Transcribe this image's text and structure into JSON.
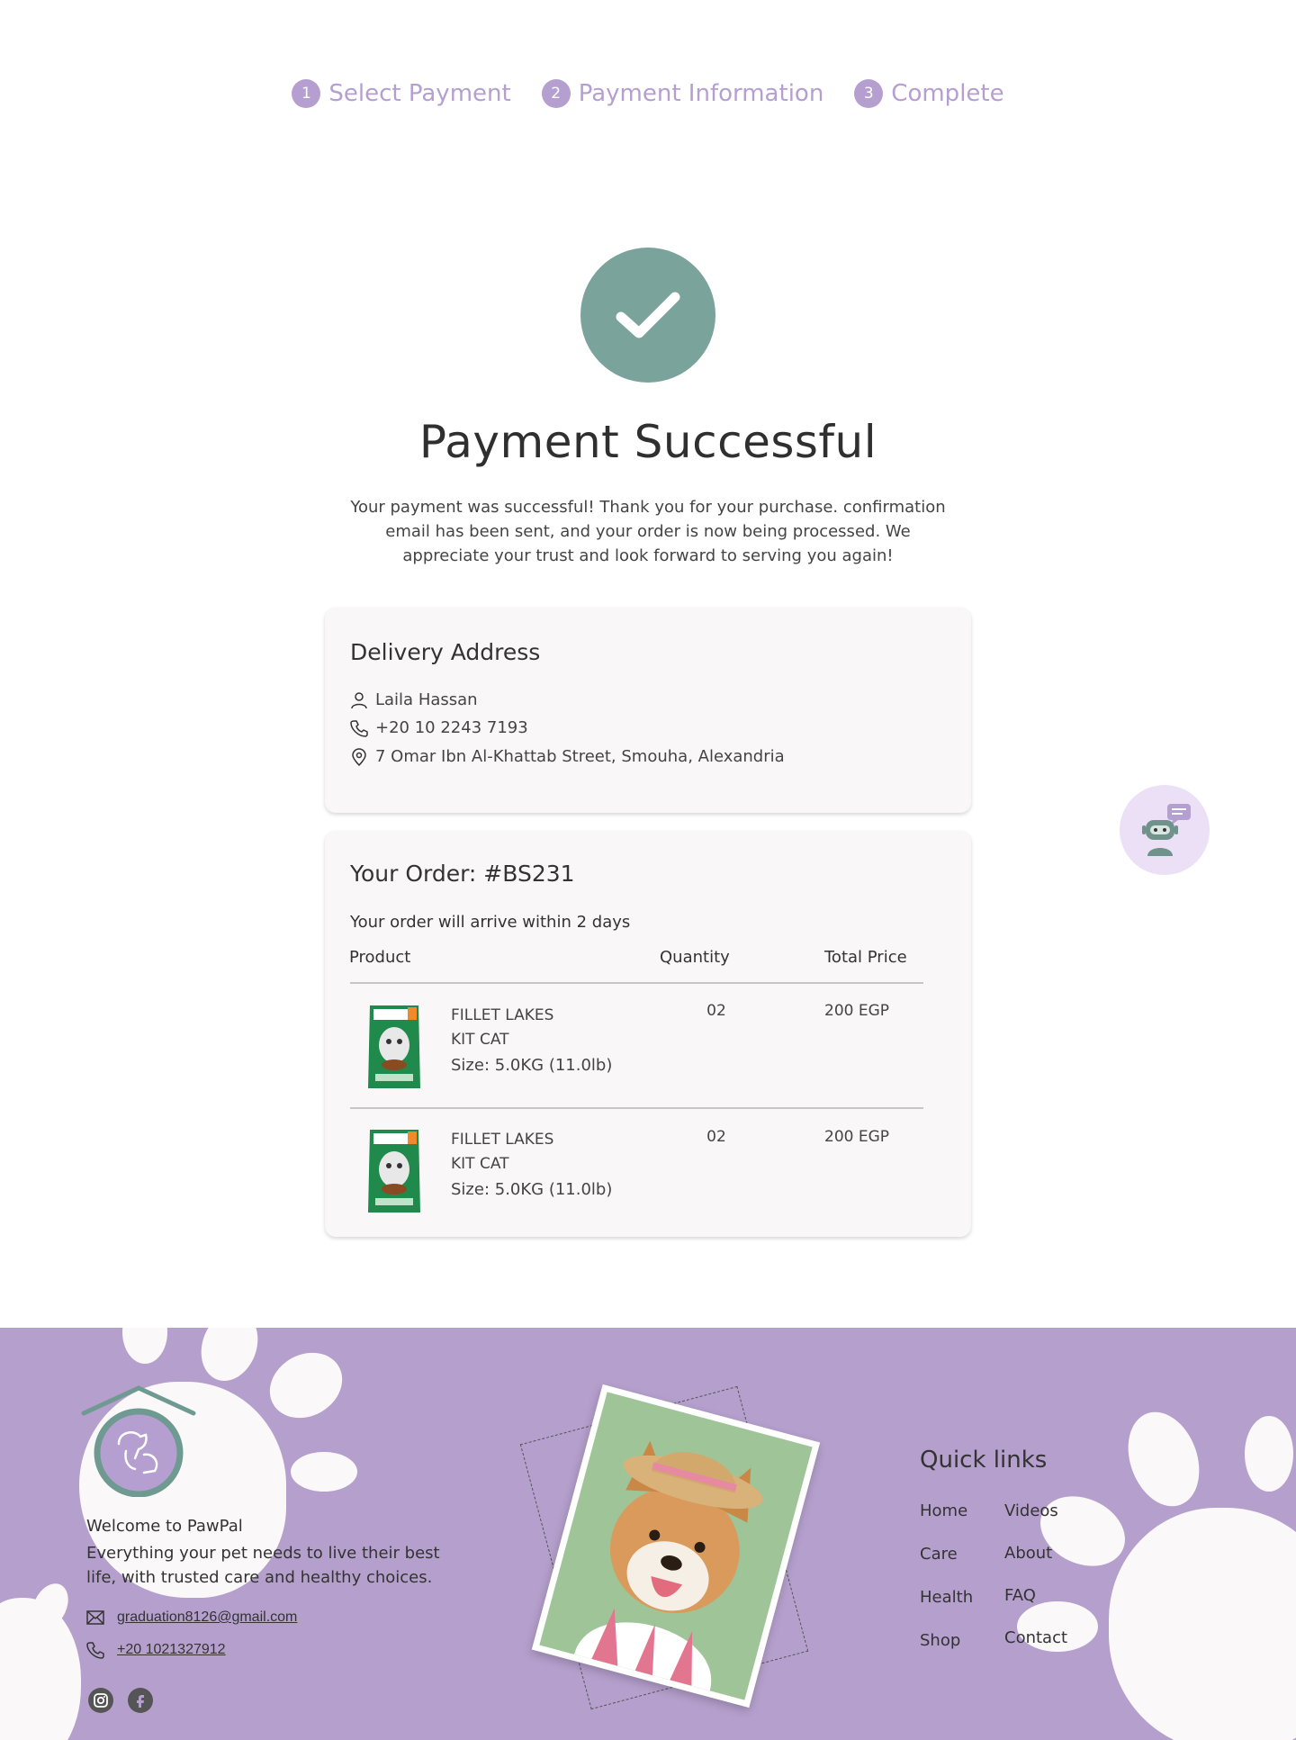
{
  "stepper": {
    "steps": [
      {
        "num": "1",
        "label": "Select Payment"
      },
      {
        "num": "2",
        "label": "Payment Information"
      },
      {
        "num": "3",
        "label": "Complete"
      }
    ]
  },
  "success": {
    "title": "Payment Successful",
    "message": "Your payment was successful! Thank you for your purchase. confirmation email has been sent, and your order is now being processed. We appreciate your trust and look forward to serving you again!"
  },
  "delivery": {
    "title": "Delivery Address",
    "name": "Laila Hassan",
    "phone": "+20 10 2243 7193",
    "address": "7 Omar Ibn Al-Khattab Street, Smouha, Alexandria"
  },
  "order": {
    "title": "Your Order: #BS231",
    "arrival": "Your order will arrive within 2 days",
    "columns": {
      "product": "Product",
      "quantity": "Quantity",
      "total": "Total Price"
    },
    "items": [
      {
        "name_line1": "FILLET LAKES",
        "name_line2": "KIT CAT",
        "size": "Size: 5.0KG (11.0lb)",
        "quantity": "02",
        "price": "200 EGP"
      },
      {
        "name_line1": "FILLET LAKES",
        "name_line2": "KIT CAT",
        "size": "Size: 5.0KG (11.0lb)",
        "quantity": "02",
        "price": "200 EGP"
      }
    ]
  },
  "footer": {
    "welcome": "Welcome to PawPal",
    "tagline": "Everything your pet needs to live their best life, with trusted care and healthy choices.",
    "email": "graduation8126@gmail.com",
    "phone": "+20 1021327912",
    "quick_links_title": "Quick links",
    "links": [
      "Home",
      "Videos",
      "Care",
      "About",
      "Health",
      "FAQ",
      "Shop",
      "Contact"
    ]
  },
  "colors": {
    "accent": "#b59fd0",
    "success": "#7aa39b",
    "footer": "#b59fcc"
  },
  "icons": [
    "check-icon",
    "user-icon",
    "phone-icon",
    "location-pin-icon",
    "chatbot-icon",
    "mail-icon",
    "instagram-icon",
    "facebook-icon",
    "pawpal-logo"
  ]
}
